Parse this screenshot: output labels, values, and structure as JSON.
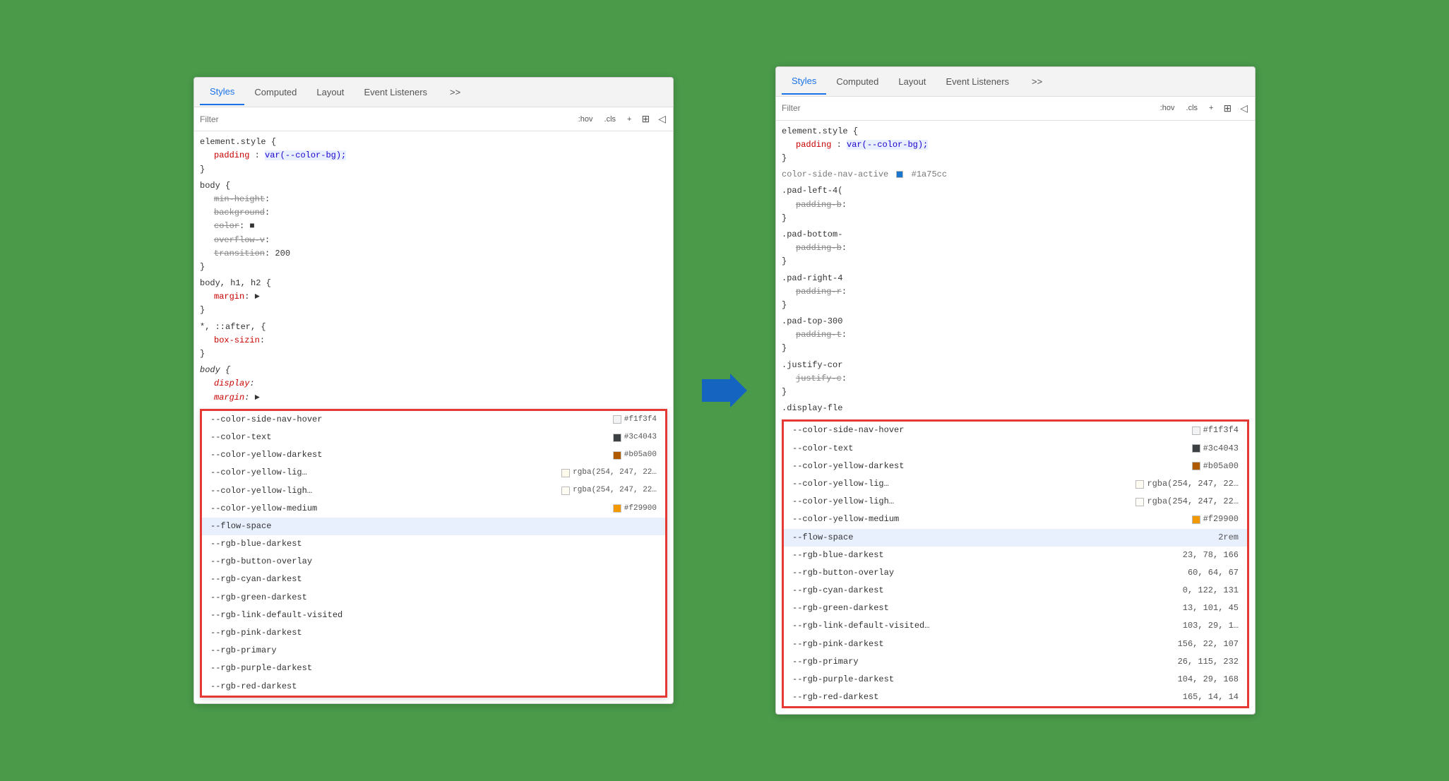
{
  "panels": {
    "left": {
      "tabs": [
        {
          "label": "Styles",
          "active": true
        },
        {
          "label": "Computed"
        },
        {
          "label": "Layout"
        },
        {
          "label": "Event Listeners"
        },
        {
          "label": ">>"
        }
      ],
      "filter_placeholder": "Filter",
      "filter_buttons": [
        ":hov",
        ".cls",
        "+"
      ],
      "element_style": {
        "selector": "element.style {",
        "props": [
          {
            "name": "padding",
            "value": "var(--color-bg);",
            "highlight": true
          }
        ],
        "close": "}"
      },
      "rules": [
        {
          "selector": "body {",
          "props": [
            {
              "name": "min-height",
              "value": "...",
              "truncated": true
            },
            {
              "name": "background",
              "value": "...",
              "truncated": true
            },
            {
              "name": "color",
              "value": "■",
              "truncated": true
            },
            {
              "name": "overflow-v",
              "value": "...",
              "truncated": true
            },
            {
              "name": "transition",
              "value": "...",
              "truncated": true
            }
          ],
          "extra": "200",
          "close": "}"
        },
        {
          "selector": "body, h1, h2 {",
          "props": [
            {
              "name": "margin",
              "value": "►",
              "truncated": true
            }
          ],
          "close": "}"
        },
        {
          "selector": "*, ::after, {",
          "props": [
            {
              "name": "box-sizin",
              "value": "...",
              "truncated": true
            }
          ],
          "close": "}"
        },
        {
          "selector": "body {",
          "italic": true,
          "props": [
            {
              "name": "display",
              "value": "...",
              "truncated": true,
              "italic": true
            },
            {
              "name": "margin",
              "value": "►",
              "truncated": true,
              "italic": true
            }
          ],
          "close": ""
        }
      ],
      "autocomplete": {
        "items": [
          {
            "name": "--color-side-nav-hover",
            "swatch": "#f1f3f4",
            "swatch_color": "#f1f3f4",
            "value": "#f1f3f4"
          },
          {
            "name": "--color-text",
            "swatch": "#3c4043",
            "swatch_color": "#3c4043",
            "value": "#3c4043"
          },
          {
            "name": "--color-yellow-darkest",
            "swatch": "#b05a00",
            "swatch_color": "#b05a00",
            "value": "#b05a00"
          },
          {
            "name": "--color-yellow-lig…",
            "swatch_transparent": true,
            "value": "rgba(254, 247, 22…"
          },
          {
            "name": "--color-yellow-ligh…",
            "swatch_transparent": true,
            "value": "rgba(254, 247, 22…"
          },
          {
            "name": "--color-yellow-medium",
            "swatch": "#f29900",
            "swatch_color": "#f29900",
            "value": "#f29900"
          },
          {
            "name": "--flow-space",
            "selected": true,
            "value": ""
          },
          {
            "name": "--rgb-blue-darkest",
            "value": ""
          },
          {
            "name": "--rgb-button-overlay",
            "value": ""
          },
          {
            "name": "--rgb-cyan-darkest",
            "value": ""
          },
          {
            "name": "--rgb-green-darkest",
            "value": ""
          },
          {
            "name": "--rgb-link-default-visited",
            "value": ""
          },
          {
            "name": "--rgb-pink-darkest",
            "value": ""
          },
          {
            "name": "--rgb-primary",
            "value": ""
          },
          {
            "name": "--rgb-purple-darkest",
            "value": ""
          },
          {
            "name": "--rgb-red-darkest",
            "value": ""
          }
        ]
      }
    },
    "right": {
      "tabs": [
        {
          "label": "Styles",
          "active": true
        },
        {
          "label": "Computed"
        },
        {
          "label": "Layout"
        },
        {
          "label": "Event Listeners"
        },
        {
          "label": ">>"
        }
      ],
      "filter_placeholder": "Filter",
      "filter_buttons": [
        ":hov",
        ".cls",
        "+"
      ],
      "element_style": {
        "selector": "element.style {",
        "props": [
          {
            "name": "padding",
            "value": "var(--color-bg);",
            "highlight": true
          }
        ],
        "close": "}"
      },
      "rules_above": [
        {
          "selector": "color-side-nav-active",
          "value": "#1a75cc",
          "has_swatch": true
        }
      ],
      "pad_rules": [
        {
          "selector": ".pad-left-4(",
          "prop": "padding-b",
          "close": "}"
        },
        {
          "selector": ".pad-bottom-",
          "prop": "padding-b",
          "close": "}"
        },
        {
          "selector": ".pad-right-4",
          "prop": "padding-r",
          "close": "}"
        },
        {
          "selector": ".pad-top-300",
          "prop": "padding-t",
          "close": "}"
        },
        {
          "selector": ".justify-cor",
          "prop": "justify-c",
          "close": "}"
        },
        {
          "selector": ".display-fle",
          "prop": "",
          "close": ""
        }
      ],
      "computed": {
        "items": [
          {
            "name": "--color-side-nav-hover",
            "swatch": "#f1f3f4",
            "swatch_color": "#f1f3f4",
            "value": "#f1f3f4"
          },
          {
            "name": "--color-text",
            "swatch": "#3c4043",
            "swatch_color": "#3c4043",
            "value": "#3c4043"
          },
          {
            "name": "--color-yellow-darkest",
            "swatch": "#b05a00",
            "swatch_color": "#b05a00",
            "value": "#b05a00"
          },
          {
            "name": "--color-yellow-lig…",
            "swatch_transparent": true,
            "value": "rgba(254, 247, 22…"
          },
          {
            "name": "--color-yellow-ligh…",
            "swatch_transparent": true,
            "value": "rgba(254, 247, 22…"
          },
          {
            "name": "--color-yellow-medium",
            "swatch": "#f29900",
            "swatch_color": "#f29900",
            "value": "#f29900"
          },
          {
            "name": "--flow-space",
            "selected": true,
            "value": "2rem"
          },
          {
            "name": "--rgb-blue-darkest",
            "value": "23, 78, 166"
          },
          {
            "name": "--rgb-button-overlay",
            "value": "60, 64, 67"
          },
          {
            "name": "--rgb-cyan-darkest",
            "value": "0, 122, 131"
          },
          {
            "name": "--rgb-green-darkest",
            "value": "13, 101, 45"
          },
          {
            "name": "--rgb-link-default-visited…",
            "value": "103, 29, 1…"
          },
          {
            "name": "--rgb-pink-darkest",
            "value": "156, 22, 107"
          },
          {
            "name": "--rgb-primary",
            "value": "26, 115, 232"
          },
          {
            "name": "--rgb-purple-darkest",
            "value": "104, 29, 168"
          },
          {
            "name": "--rgb-red-darkest",
            "value": "165, 14, 14"
          }
        ]
      }
    }
  },
  "arrow": "→"
}
